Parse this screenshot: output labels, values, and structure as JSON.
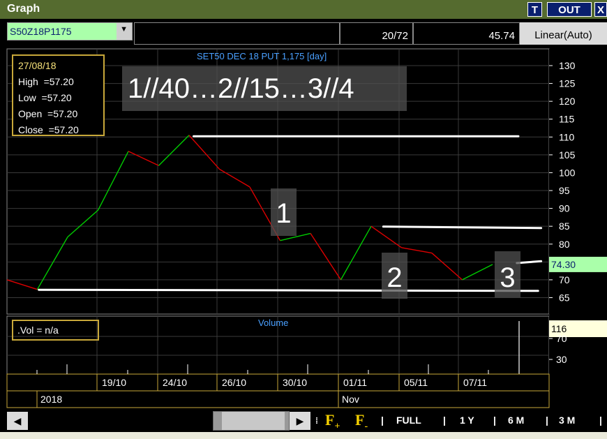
{
  "window": {
    "title": "Graph",
    "buttons": [
      "T",
      "OUT",
      "X"
    ]
  },
  "toolbar": {
    "symbol": "S50Z18P1175",
    "count": "20/72",
    "value": "45.74",
    "scale": "Linear(Auto)"
  },
  "info": {
    "date": "27/08/18",
    "high": "High  =57.20",
    "low": "Low  =57.20",
    "open": "Open  =57.20",
    "close": "Close  =57.20"
  },
  "annotations": {
    "header": "1//40…2//15…3//4",
    "label1": "1",
    "label2": "2",
    "label3": "3"
  },
  "volume": {
    "label": ".Vol   = n/a",
    "title": "Volume",
    "current": "116",
    "ticks": [
      "70",
      "30"
    ]
  },
  "colors": {
    "up": "#00cc00",
    "down": "#dd0000",
    "grid": "#3a3a3a",
    "frame": "#c8a83a",
    "title_blue": "#4aa0ff",
    "last_price_bg": "#aaffaa",
    "volume_bg": "#ffffdd"
  },
  "chart_data": {
    "type": "line",
    "title": "SET50 DEC 18 PUT 1,175 [day]",
    "xlabel": "",
    "ylabel": "",
    "ylim": [
      62,
      133
    ],
    "y_ticks": [
      130,
      125,
      120,
      115,
      110,
      105,
      100,
      95,
      90,
      85,
      80,
      75,
      70,
      65
    ],
    "grid": true,
    "x_labels": [
      "19/10",
      "24/10",
      "26/10",
      "30/10",
      "01/11",
      "05/11",
      "07/11"
    ],
    "x_year": "2018",
    "x_month": "Nov",
    "last_price": "74.30",
    "values": [
      70,
      67.3,
      82,
      89.5,
      106,
      102,
      110.5,
      101,
      96,
      81,
      83,
      70,
      85,
      79,
      77.5,
      70,
      74.3
    ],
    "trendlines": [
      {
        "from": [
          6.15,
          110.2
        ],
        "to": [
          16.85,
          110.2
        ]
      },
      {
        "from": [
          12.4,
          84.9
        ],
        "to": [
          17.6,
          84.5
        ]
      },
      {
        "from": [
          1.05,
          67.2
        ],
        "to": [
          17.5,
          66.9
        ]
      },
      {
        "from": [
          16.8,
          74.7
        ],
        "to": [
          17.6,
          75.2
        ]
      }
    ]
  }
}
